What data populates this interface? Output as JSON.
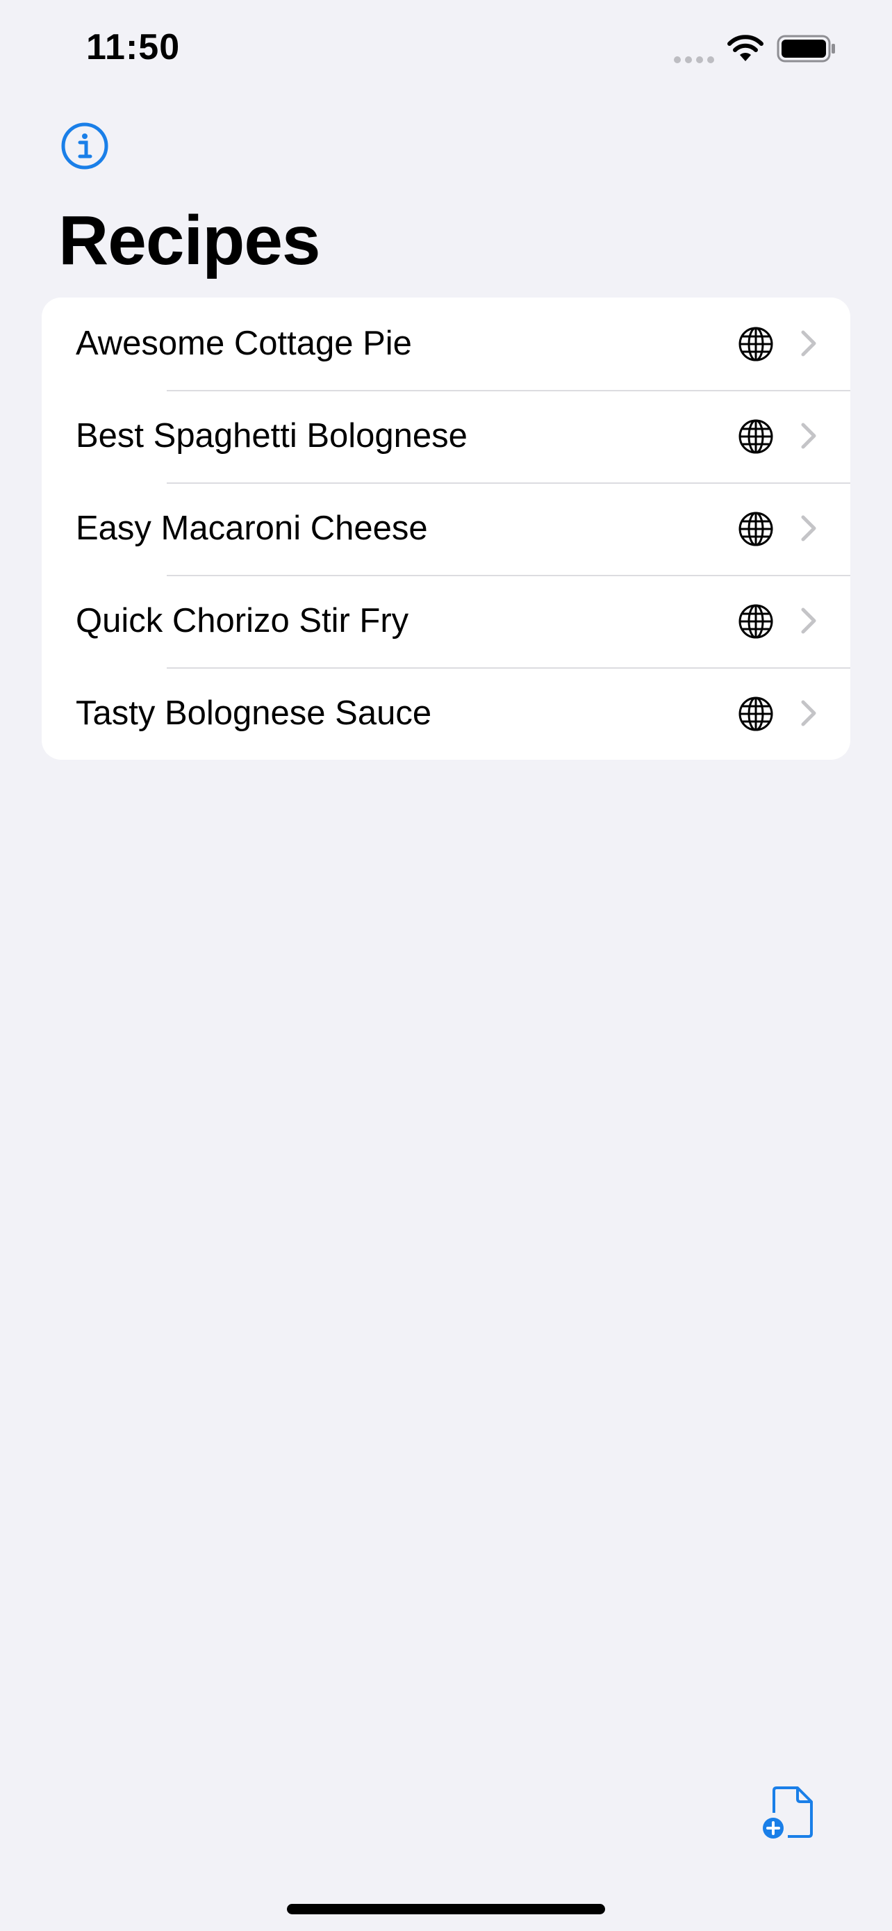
{
  "status_bar": {
    "time": "11:50"
  },
  "nav": {
    "title": "Recipes",
    "info_icon": "info-circle-icon",
    "accent_color": "#1a7fe8"
  },
  "recipes": [
    {
      "label": "Awesome Cottage Pie",
      "icon": "globe-icon"
    },
    {
      "label": "Best Spaghetti Bolognese",
      "icon": "globe-icon"
    },
    {
      "label": "Easy Macaroni Cheese",
      "icon": "globe-icon"
    },
    {
      "label": "Quick Chorizo Stir Fry",
      "icon": "globe-icon"
    },
    {
      "label": "Tasty Bolognese Sauce",
      "icon": "globe-icon"
    }
  ],
  "toolbar": {
    "new_document_icon": "doc-badge-plus-icon"
  }
}
